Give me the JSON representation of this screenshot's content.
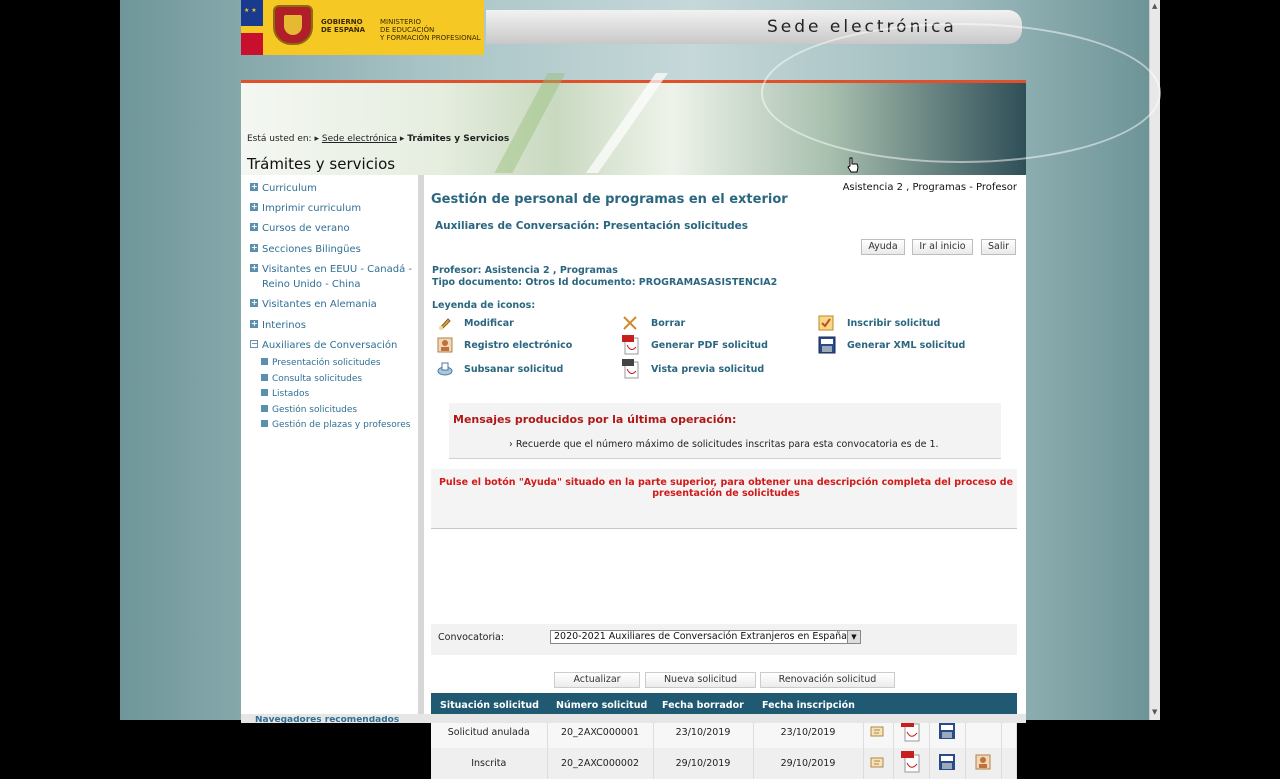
{
  "header": {
    "gov_left": "GOBIERNO\nDE ESPAÑA",
    "gov_right": "MINISTERIO\nDE EDUCACIÓN\nY FORMACIÓN PROFESIONAL",
    "site_title": "Sede electrónica"
  },
  "breadcrumb": {
    "prefix": "Está usted en:",
    "link": "Sede electrónica",
    "current": "Trámites y Servicios"
  },
  "page_title": "Trámites y servicios",
  "sidebar": {
    "items": [
      {
        "label": "Curriculum"
      },
      {
        "label": "Imprimir curriculum"
      },
      {
        "label": "Cursos de verano"
      },
      {
        "label": "Secciones Bilingües"
      },
      {
        "label": "Visitantes en EEUU - Canadá -"
      },
      {
        "label": "Reino Unido - China"
      },
      {
        "label": "Visitantes en Alemania"
      },
      {
        "label": "Interinos"
      },
      {
        "label": "Auxiliares de Conversación"
      }
    ],
    "subitems": [
      {
        "label": "Presentación solicitudes"
      },
      {
        "label": "Consulta solicitudes"
      },
      {
        "label": "Listados"
      },
      {
        "label": "Gestión solicitudes"
      },
      {
        "label": "Gestión de plazas y profesores"
      }
    ]
  },
  "main": {
    "heading": "Gestión de personal de programas en el exterior",
    "user": "Asistencia 2 , Programas - Profesor",
    "subheading": "Auxiliares de Conversación: Presentación solicitudes",
    "buttons": {
      "help": "Ayuda",
      "home": "Ir al inicio",
      "exit": "Salir"
    },
    "profesor": "Profesor: Asistencia 2 , Programas",
    "documento": "Tipo documento: Otros Id documento: PROGRAMASASISTENCIA2",
    "legend_title": "Leyenda de iconos:",
    "legend": {
      "modificar": "Modificar",
      "borrar": "Borrar",
      "inscribir": "Inscribir solicitud",
      "registro": "Registro electrónico",
      "pdf": "Generar PDF solicitud",
      "xml": "Generar XML solicitud",
      "subsanar": "Subsanar solicitud",
      "vista": "Vista previa solicitud"
    },
    "messages_title": "Mensajes producidos por la última operación:",
    "message_item": "Recuerde que el número máximo de solicitudes inscritas para esta convocatoria es de 1.",
    "hint_line1": "Pulse el botón \"Ayuda\" situado en la parte superior, para obtener una descripción completa del proceso de",
    "hint_line2": "presentación de solicitudes",
    "convocatoria_label": "Convocatoria:",
    "convocatoria_value": "2020-2021 Auxiliares de Conversación Extranjeros en España",
    "actions": {
      "refresh": "Actualizar",
      "new": "Nueva solicitud",
      "renew": "Renovación solicitud"
    },
    "table": {
      "headers": [
        "Situación solicitud",
        "Número solicitud",
        "Fecha borrador",
        "Fecha inscripción"
      ],
      "rows": [
        [
          "Solicitud anulada",
          "20_2AXC000001",
          "23/10/2019",
          "23/10/2019"
        ],
        [
          "Inscrita",
          "20_2AXC000002",
          "29/10/2019",
          "29/10/2019"
        ]
      ]
    }
  },
  "footer": "Navegadores recomendados",
  "colors": {
    "accent": "#2a6680",
    "table_header": "#1f5a72",
    "error": "#d11a1a",
    "link": "#2f6f94"
  }
}
